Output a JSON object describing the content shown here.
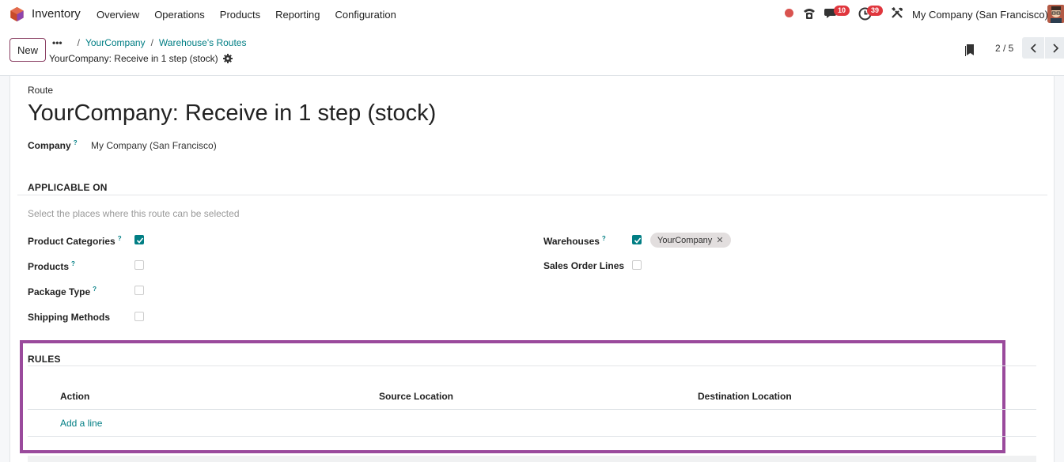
{
  "navbar": {
    "app_name": "Inventory",
    "menu": [
      "Overview",
      "Operations",
      "Products",
      "Reporting",
      "Configuration"
    ],
    "chat_badge": "10",
    "activity_badge": "39",
    "company": "My Company (San Francisco)"
  },
  "control": {
    "new_label": "New",
    "breadcrumb": {
      "dots": "•••",
      "item1": "YourCompany",
      "item2": "Warehouse's Routes"
    },
    "record_title": "YourCompany: Receive in 1 step (stock)",
    "pager": "2 / 5"
  },
  "form": {
    "route_label": "Route",
    "route_name": "YourCompany: Receive in 1 step (stock)",
    "company_label": "Company",
    "company_help": "?",
    "company_value": "My Company (San Francisco)",
    "applicable_on": "APPLICABLE ON",
    "hint": "Select the places where this route can be selected",
    "fields": {
      "product_categories": {
        "label": "Product Categories",
        "help": "?",
        "checked": true
      },
      "products": {
        "label": "Products",
        "help": "?",
        "checked": false
      },
      "package_type": {
        "label": "Package Type",
        "help": "?",
        "checked": false
      },
      "shipping_methods": {
        "label": "Shipping Methods",
        "checked": false
      },
      "warehouses": {
        "label": "Warehouses",
        "help": "?",
        "checked": true,
        "tag": "YourCompany"
      },
      "sales_order_lines": {
        "label": "Sales Order Lines",
        "checked": false
      }
    },
    "rules": {
      "title": "RULES",
      "columns": [
        "Action",
        "Source Location",
        "Destination Location"
      ],
      "add_line": "Add a line"
    }
  },
  "colors": {
    "accent": "#017e84",
    "brand": "#8a3f62",
    "highlight": "#9a4a9c"
  }
}
